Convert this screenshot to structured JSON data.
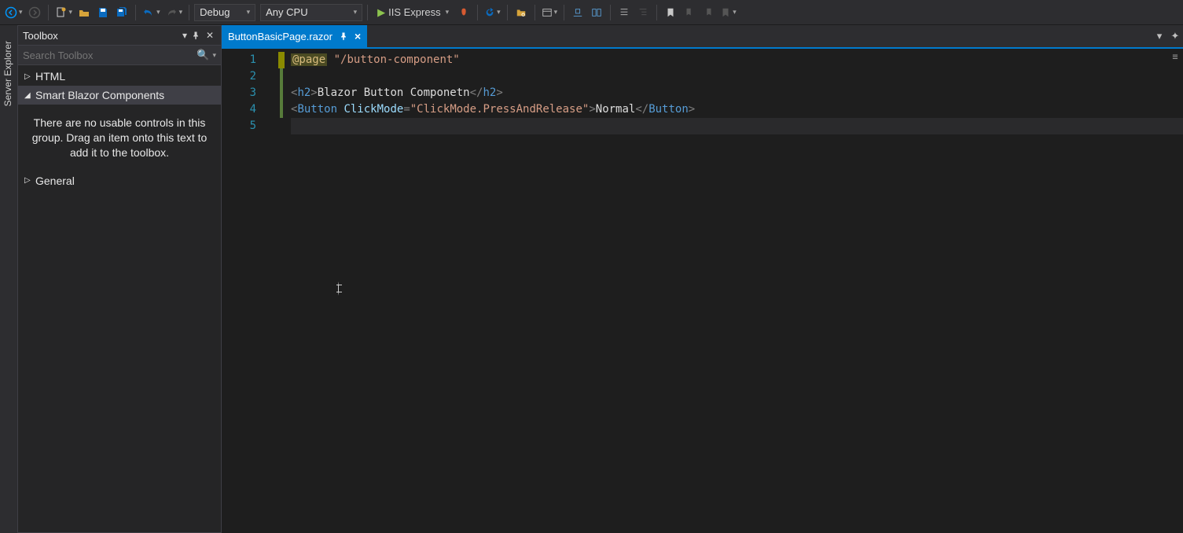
{
  "toolbar": {
    "config": "Debug",
    "platform": "Any CPU",
    "run_target": "IIS Express"
  },
  "sidebar": {
    "tab_label": "Server Explorer"
  },
  "toolbox": {
    "title": "Toolbox",
    "search_placeholder": "Search Toolbox",
    "items": [
      {
        "label": "HTML",
        "expanded": false,
        "selected": false
      },
      {
        "label": "Smart Blazor Components",
        "expanded": true,
        "selected": true
      },
      {
        "label": "General",
        "expanded": false,
        "selected": false
      }
    ],
    "empty_message": "There are no usable controls in this group. Drag an item onto this text to add it to the toolbox."
  },
  "tab": {
    "filename": "ButtonBasicPage.razor"
  },
  "editor": {
    "line_numbers": [
      "1",
      "2",
      "3",
      "4",
      "5"
    ],
    "line1": {
      "directive": "@page",
      "string": "\"/button-component\""
    },
    "line3": {
      "open": "<",
      "tag1": "h2",
      "close1": ">",
      "text": "Blazor Button Componetn",
      "open2": "</",
      "tag2": "h2",
      "close2": ">"
    },
    "line4": {
      "open": "<",
      "tag": "Button",
      "sp": " ",
      "attr": "ClickMode",
      "eq": "=",
      "val": "\"ClickMode.PressAndRelease\"",
      "close": ">",
      "text": "Normal",
      "open2": "</",
      "tag2": "Button",
      "close2": ">"
    }
  }
}
